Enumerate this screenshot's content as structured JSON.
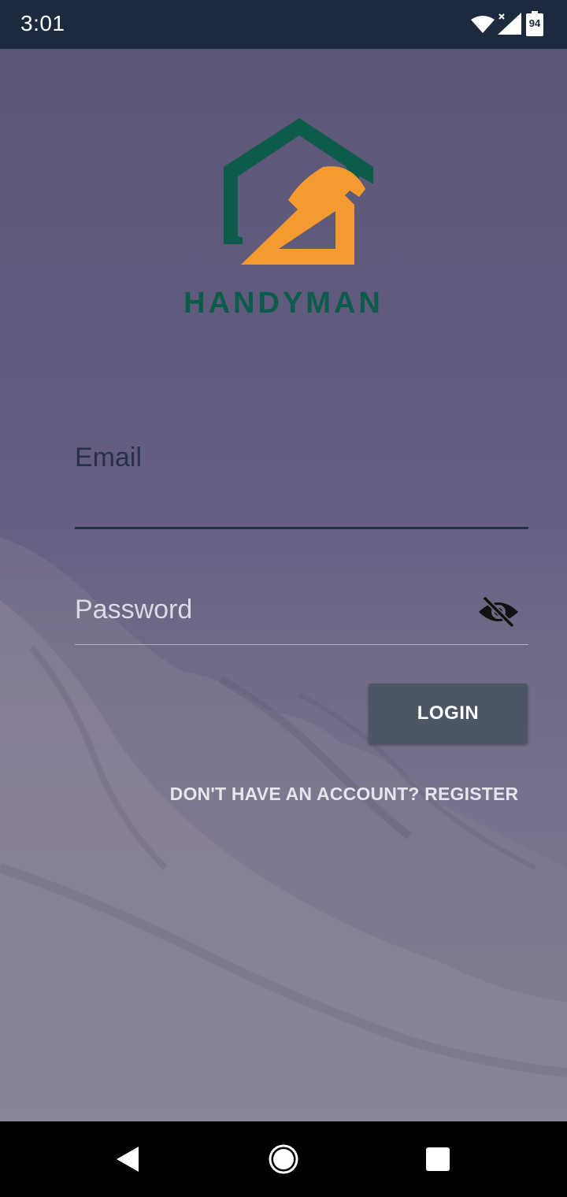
{
  "status_bar": {
    "time": "3:01",
    "battery_level": "94",
    "icons": [
      "wifi-icon",
      "signal-icon",
      "battery-icon"
    ]
  },
  "brand": {
    "name": "HANDYMAN",
    "logo_icon": "house-hammer-logo",
    "colors": {
      "primary": "#0d5b4a",
      "accent": "#f59a2e"
    }
  },
  "login_form": {
    "email_label": "Email",
    "password_label": "Password",
    "password_toggle_icon": "eye-off-icon",
    "login_button": "LOGIN",
    "register_link": "DON'T HAVE AN ACCOUNT? REGISTER"
  },
  "nav_bar": {
    "buttons": [
      "back-icon",
      "home-icon",
      "recents-icon"
    ]
  }
}
